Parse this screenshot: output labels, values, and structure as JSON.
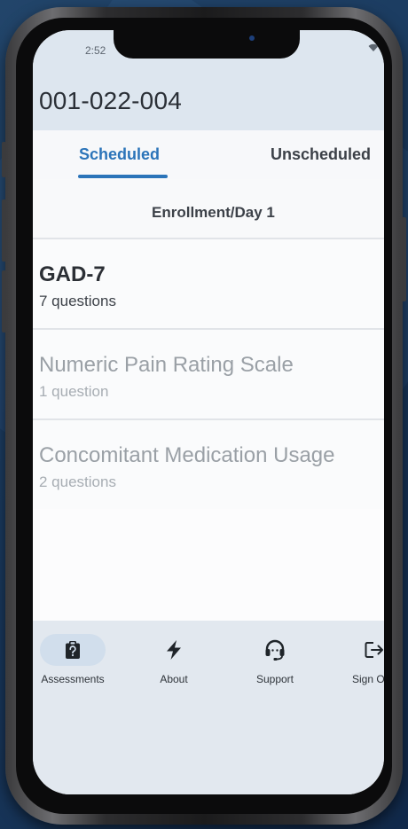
{
  "status_bar": {
    "time": "2:52"
  },
  "header": {
    "title": "001-022-004"
  },
  "tabs": [
    {
      "label": "Scheduled",
      "active": true
    },
    {
      "label": "Unscheduled",
      "active": false
    }
  ],
  "visit": {
    "label": "Enrollment/Day 1"
  },
  "assessments": [
    {
      "title": "GAD-7",
      "subtitle": "7 questions",
      "enabled": true
    },
    {
      "title": "Numeric Pain Rating Scale",
      "subtitle": "1 question",
      "enabled": false
    },
    {
      "title": "Concomitant Medication Usage",
      "subtitle": "2 questions",
      "enabled": false
    }
  ],
  "bottom_nav": [
    {
      "label": "Assessments",
      "icon": "clipboard-icon",
      "active": true
    },
    {
      "label": "About",
      "icon": "lightning-icon",
      "active": false
    },
    {
      "label": "Support",
      "icon": "headset-icon",
      "active": false
    },
    {
      "label": "Sign Out",
      "icon": "sign-out-icon",
      "active": false
    }
  ],
  "colors": {
    "accent": "#2b74b9",
    "header_bg": "#dde6ef",
    "nav_bg": "#e2e8ef",
    "active_pill": "#d1deec"
  }
}
